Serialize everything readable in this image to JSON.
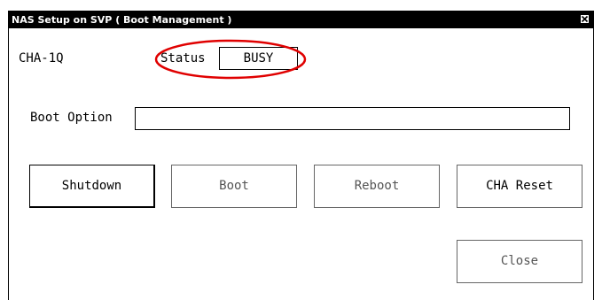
{
  "window": {
    "title": "NAS Setup on SVP ( Boot Management )"
  },
  "cha": {
    "name": "CHA-1Q"
  },
  "status": {
    "label": "Status",
    "value": "BUSY"
  },
  "boot_option": {
    "label": "Boot Option",
    "value": ""
  },
  "buttons": {
    "shutdown": "Shutdown",
    "boot": "Boot",
    "reboot": "Reboot",
    "cha_reset": "CHA Reset",
    "close": "Close"
  },
  "colors": {
    "highlight_ring": "#e00000",
    "titlebar": "#000000"
  }
}
